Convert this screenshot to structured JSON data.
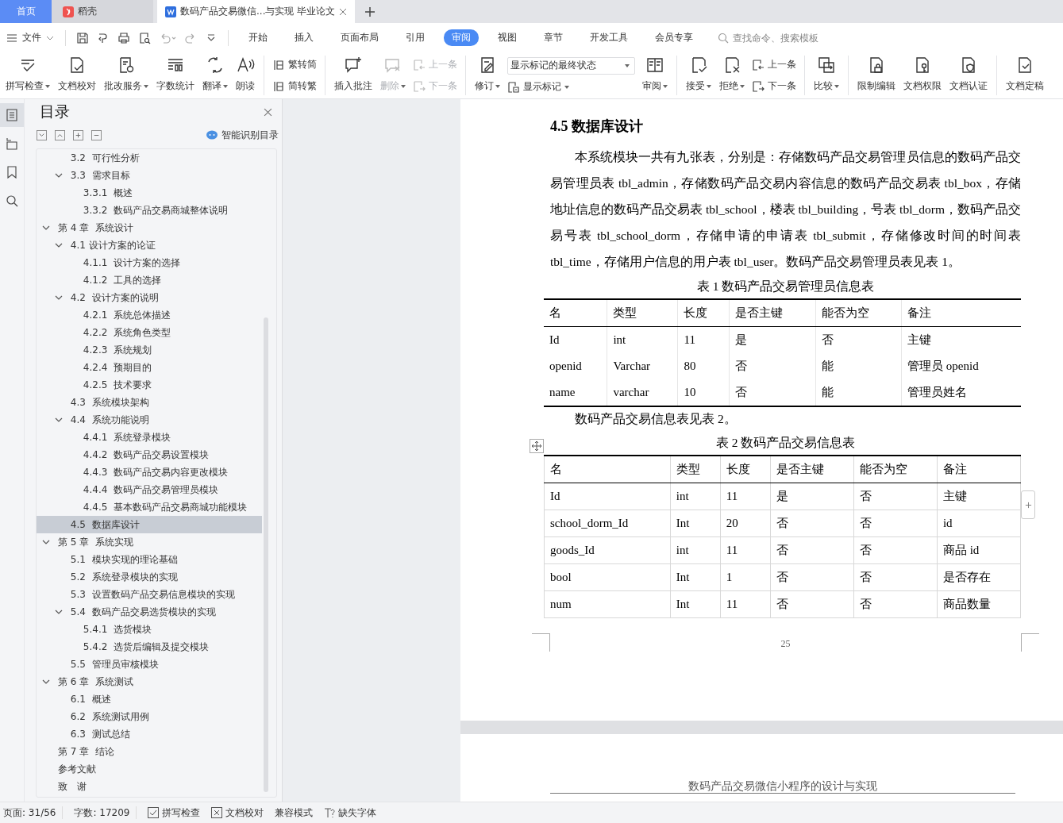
{
  "tabs": [
    {
      "label": "首页",
      "kind": "home",
      "selected": false
    },
    {
      "label": "稻壳",
      "kind": "app",
      "selected": false
    },
    {
      "label": "数码产品交易微信...与实现 毕业论文",
      "kind": "document",
      "selected": true
    }
  ],
  "menu": {
    "file": "文件",
    "tabs": [
      {
        "label": "开始",
        "selected": false
      },
      {
        "label": "插入",
        "selected": false
      },
      {
        "label": "页面布局",
        "selected": false
      },
      {
        "label": "引用",
        "selected": false
      },
      {
        "label": "审阅",
        "selected": true
      },
      {
        "label": "视图",
        "selected": false
      },
      {
        "label": "章节",
        "selected": false
      },
      {
        "label": "开发工具",
        "selected": false
      },
      {
        "label": "会员专享",
        "selected": false
      }
    ],
    "search_placeholder": "查找命令、搜索模板"
  },
  "ribbon": {
    "groups": [
      [
        {
          "kind": "big",
          "label": "拼写检查",
          "dropdown": true,
          "disabled": false
        },
        {
          "kind": "big",
          "label": "文档校对",
          "dropdown": false,
          "disabled": false
        },
        {
          "kind": "big",
          "label": "批改服务",
          "dropdown": true,
          "disabled": false
        },
        {
          "kind": "big",
          "label": "字数统计",
          "dropdown": false,
          "disabled": false
        },
        {
          "kind": "big",
          "label": "翻译",
          "dropdown": true,
          "disabled": false
        },
        {
          "kind": "big",
          "label": "朗读",
          "dropdown": false,
          "disabled": false
        }
      ],
      [
        {
          "kind": "stack",
          "rows": [
            {
              "label": "繁转简",
              "disabled": false
            },
            {
              "label": "简转繁",
              "disabled": false
            }
          ]
        }
      ],
      [
        {
          "kind": "big",
          "label": "插入批注",
          "dropdown": false,
          "disabled": false
        },
        {
          "kind": "big",
          "label": "删除",
          "dropdown": true,
          "disabled": true
        },
        {
          "kind": "stack",
          "rows": [
            {
              "label": "上一条",
              "disabled": true
            },
            {
              "label": "下一条",
              "disabled": true
            }
          ]
        }
      ],
      [
        {
          "kind": "big",
          "label": "修订",
          "dropdown": true,
          "disabled": false
        },
        {
          "kind": "select",
          "value": "显示标记的最终状态",
          "button": "显示标记"
        },
        {
          "kind": "big",
          "label": "审阅",
          "dropdown": true,
          "disabled": false
        }
      ],
      [
        {
          "kind": "big",
          "label": "接受",
          "dropdown": true,
          "disabled": false
        },
        {
          "kind": "big",
          "label": "拒绝",
          "dropdown": true,
          "disabled": false
        },
        {
          "kind": "stack",
          "rows": [
            {
              "label": "上一条",
              "disabled": false
            },
            {
              "label": "下一条",
              "disabled": false
            }
          ]
        }
      ],
      [
        {
          "kind": "big",
          "label": "比较",
          "dropdown": true,
          "disabled": false
        }
      ],
      [
        {
          "kind": "big",
          "label": "限制编辑",
          "dropdown": false,
          "disabled": false
        },
        {
          "kind": "big",
          "label": "文档权限",
          "dropdown": false,
          "disabled": false
        },
        {
          "kind": "big",
          "label": "文档认证",
          "dropdown": false,
          "disabled": false
        }
      ],
      [
        {
          "kind": "big",
          "label": "文档定稿",
          "dropdown": false,
          "disabled": false
        }
      ]
    ]
  },
  "toc": {
    "title": "目录",
    "smart_button": "智能识别目录",
    "continued_items": [
      {
        "label": "3.2  可行性分析",
        "selected": false
      },
      {
        "label": "3.3  需求目标",
        "selected": false,
        "expanded": true,
        "children": [
          {
            "label": "3.3.1  概述",
            "selected": false
          },
          {
            "label": "3.3.2  数码产品交易商城整体说明",
            "selected": false
          }
        ]
      }
    ],
    "items": [
      {
        "label": "第 4 章  系统设计",
        "selected": false,
        "expanded": true,
        "children": [
          {
            "label": "4.1 设计方案的论证",
            "selected": false,
            "expanded": true,
            "children": [
              {
                "label": "4.1.1  设计方案的选择",
                "selected": false
              },
              {
                "label": "4.1.2  工具的选择",
                "selected": false
              }
            ]
          },
          {
            "label": "4.2  设计方案的说明",
            "selected": false,
            "expanded": true,
            "children": [
              {
                "label": "4.2.1  系统总体描述",
                "selected": false
              },
              {
                "label": "4.2.2  系统角色类型",
                "selected": false
              },
              {
                "label": "4.2.3  系统规划",
                "selected": false
              },
              {
                "label": "4.2.4  预期目的",
                "selected": false
              },
              {
                "label": "4.2.5  技术要求",
                "selected": false
              }
            ]
          },
          {
            "label": "4.3  系统模块架构",
            "selected": false
          },
          {
            "label": "4.4  系统功能说明",
            "selected": false,
            "expanded": true,
            "children": [
              {
                "label": "4.4.1  系统登录模块",
                "selected": false
              },
              {
                "label": "4.4.2  数码产品交易设置模块",
                "selected": false
              },
              {
                "label": "4.4.3  数码产品交易内容更改模块",
                "selected": false
              },
              {
                "label": "4.4.4  数码产品交易管理员模块",
                "selected": false
              },
              {
                "label": "4.4.5  基本数码产品交易商城功能模块",
                "selected": false
              }
            ]
          },
          {
            "label": "4.5  数据库设计",
            "selected": true
          }
        ]
      },
      {
        "label": "第 5 章  系统实现",
        "selected": false,
        "expanded": true,
        "children": [
          {
            "label": "5.1  模块实现的理论基础",
            "selected": false
          },
          {
            "label": "5.2  系统登录模块的实现",
            "selected": false
          },
          {
            "label": "5.3  设置数码产品交易信息模块的实现",
            "selected": false
          },
          {
            "label": "5.4  数码产品交易选货模块的实现",
            "selected": false,
            "expanded": true,
            "children": [
              {
                "label": "5.4.1  选货模块",
                "selected": false
              },
              {
                "label": "5.4.2  选货后编辑及提交模块",
                "selected": false
              }
            ]
          },
          {
            "label": "5.5  管理员审核模块",
            "selected": false
          }
        ]
      },
      {
        "label": "第 6 章  系统测试",
        "selected": false,
        "expanded": true,
        "children": [
          {
            "label": "6.1  概述",
            "selected": false
          },
          {
            "label": "6.2  系统测试用例",
            "selected": false
          },
          {
            "label": "6.3  测试总结",
            "selected": false
          }
        ]
      },
      {
        "label": "第 7 章  结论",
        "selected": false
      },
      {
        "label": "参考文献",
        "selected": false
      },
      {
        "label": "致　谢",
        "selected": false
      }
    ]
  },
  "document": {
    "heading": "4.5  数据库设计",
    "paragraph": "本系统模块一共有九张表，分别是：存储数码产品交易管理员信息的数码产品交易管理员表 tbl_admin，存储数码产品交易内容信息的数码产品交易表 tbl_box，存储地址信息的数码产品交易表 tbl_school，楼表 tbl_building，号表 tbl_dorm，数码产品交易号表 tbl_school_dorm，存储申请的申请表 tbl_submit，存储修改时间的时间表 tbl_time，存储用户信息的用户表 tbl_user。数码产品交易管理员表见表 1。",
    "tables": [
      {
        "caption": "表 1  数码产品交易管理员信息表",
        "columns": [
          "名",
          "类型",
          "长度",
          "是否主键",
          "能否为空",
          "备注"
        ],
        "rows": [
          [
            "Id",
            "int",
            "11",
            "是",
            "否",
            "主键"
          ],
          [
            "openid",
            "Varchar",
            "80",
            "否",
            "能",
            "管理员 openid"
          ],
          [
            "name",
            "varchar",
            "10",
            "否",
            "能",
            "管理员姓名"
          ]
        ]
      },
      {
        "caption": "表 2  数码产品交易信息表",
        "intro": "数码产品交易信息表见表 2。",
        "columns": [
          "名",
          "类型",
          "长度",
          "是否主键",
          "能否为空",
          "备注"
        ],
        "rows": [
          [
            "Id",
            "int",
            "11",
            "是",
            "否",
            "主键"
          ],
          [
            "school_dorm_Id",
            "Int",
            "20",
            "否",
            "否",
            "id"
          ],
          [
            "goods_Id",
            "int",
            "11",
            "否",
            "否",
            "商品 id"
          ],
          [
            "bool",
            "Int",
            "1",
            "否",
            "否",
            "是否存在"
          ],
          [
            "num",
            "Int",
            "11",
            "否",
            "否",
            "商品数量"
          ]
        ]
      }
    ],
    "page_number": "25",
    "next_page_header": "数码产品交易微信小程序的设计与实现"
  },
  "status_bar": [
    {
      "kind": "text",
      "label": "页面: 31/56"
    },
    {
      "kind": "text",
      "label": "字数: 17209"
    },
    {
      "kind": "spell",
      "label": "拼写检查"
    },
    {
      "kind": "proof",
      "label": "文档校对"
    },
    {
      "kind": "text",
      "label": "兼容模式"
    },
    {
      "kind": "font",
      "label": "缺失字体"
    }
  ]
}
